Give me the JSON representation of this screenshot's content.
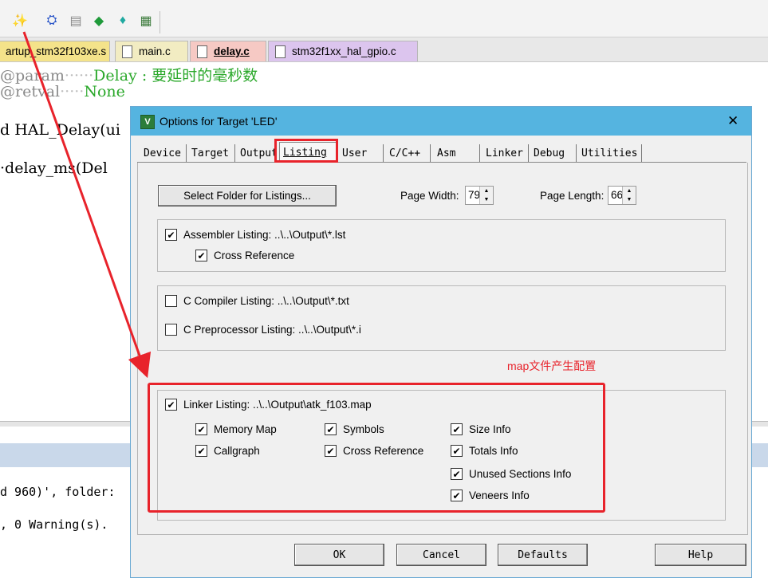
{
  "file_tabs": [
    {
      "label": "artup_stm32f103xe.s",
      "color": "#f4e38a"
    },
    {
      "label": "main.c",
      "color": "#f2ecc2"
    },
    {
      "label": "delay.c",
      "color": "#f6c9c4",
      "active": true
    },
    {
      "label": "stm32f1xx_hal_gpio.c",
      "color": "#dcc5ee"
    }
  ],
  "code": {
    "line1_kw": "@param",
    "line1_dots": "······",
    "line1_text": "Delay : 要延时的毫秒数",
    "line2_kw": "@retval",
    "line2_dots": "·····",
    "line2_text": "None",
    "line3": "d HAL_Delay(ui",
    "line4": "·delay_ms(Del"
  },
  "output": {
    "line1": "d 960)', folder:",
    "line2": ", 0 Warning(s)."
  },
  "dialog": {
    "title": "Options for Target 'LED'",
    "close": "✕",
    "tabs": [
      "Device",
      "Target",
      "Output",
      "Listing",
      "User",
      "C/C++",
      "Asm",
      "Linker",
      "Debug",
      "Utilities"
    ],
    "active_tab": "Listing",
    "select_folder": "Select Folder for Listings...",
    "page_width_label": "Page Width:",
    "page_width": "79",
    "page_length_label": "Page Length:",
    "page_length": "66",
    "assembler_listing": "Assembler Listing:  ..\\..\\Output\\*.lst",
    "asm_cross_reference": "Cross Reference",
    "c_compiler_listing": "C Compiler Listing:  ..\\..\\Output\\*.txt",
    "c_preprocessor_listing": "C Preprocessor Listing:  ..\\..\\Output\\*.i",
    "linker_listing": "Linker Listing:  ..\\..\\Output\\atk_f103.map",
    "memory_map": "Memory Map",
    "symbols": "Symbols",
    "size_info": "Size Info",
    "callgraph": "Callgraph",
    "cross_reference": "Cross Reference",
    "totals_info": "Totals Info",
    "unused_sections_info": "Unused Sections Info",
    "veneers_info": "Veneers Info",
    "ok": "OK",
    "cancel": "Cancel",
    "defaults": "Defaults",
    "help": "Help"
  },
  "annotation": {
    "label": "map文件产生配置",
    "color": "#e8232b"
  }
}
